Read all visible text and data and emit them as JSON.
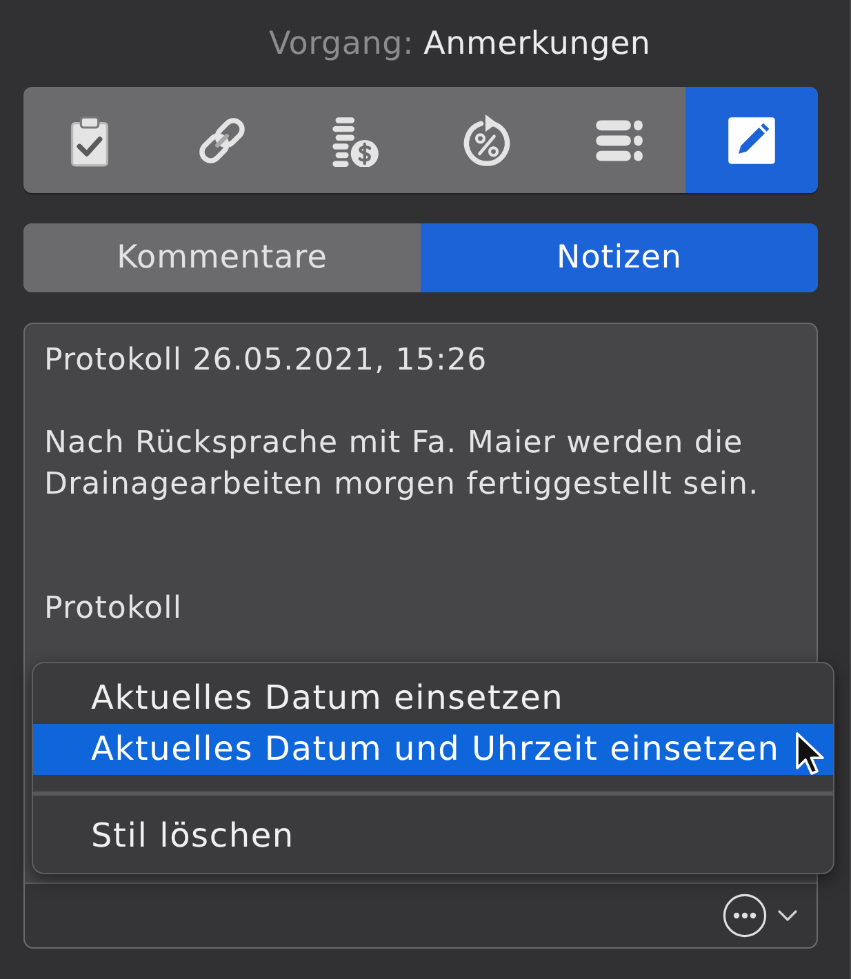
{
  "header": {
    "label": "Vorgang:",
    "title": "Anmerkungen"
  },
  "toolbar": {
    "buttons": [
      {
        "kind": "clipboard",
        "selected": false
      },
      {
        "kind": "link",
        "selected": false
      },
      {
        "kind": "coins",
        "selected": false
      },
      {
        "kind": "percent",
        "selected": false
      },
      {
        "kind": "list",
        "selected": false
      },
      {
        "kind": "edit",
        "selected": true
      }
    ]
  },
  "view_tabs": [
    {
      "label": "Kommentare",
      "selected": false
    },
    {
      "label": "Notizen",
      "selected": true
    }
  ],
  "notes": {
    "value": "Protokoll 26.05.2021, 15:26\n\nNach Rücksprache mit Fa. Maier werden die\nDrainagearbeiten morgen fertiggestellt sein.\n\n\nProtokoll"
  },
  "context_menu": {
    "items": [
      {
        "kind": "item",
        "label": "Aktuelles Datum einsetzen",
        "selected": false
      },
      {
        "kind": "item",
        "label": "Aktuelles Datum und Uhrzeit einsetzen",
        "selected": true
      },
      {
        "kind": "separator"
      },
      {
        "kind": "item",
        "label": "Stil löschen",
        "selected": false
      }
    ]
  }
}
